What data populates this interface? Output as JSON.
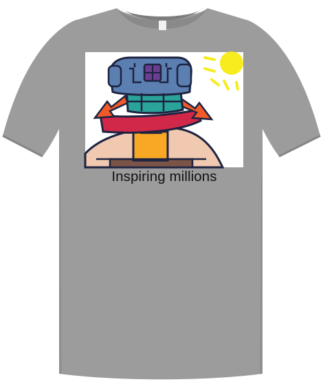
{
  "product": {
    "kind": "t-shirt",
    "print_caption": "Inspiring millions"
  },
  "colors": {
    "shirt": "#9c9c9c",
    "shirt_shadow": "#8a8a8a",
    "print_background": "#ffffff",
    "sun": "#f6ec1e",
    "outline": "#1d2340",
    "robot_blue": "#5b7fb0",
    "robot_teal": "#2aa39a",
    "robot_purple": "#6a3d8f",
    "robot_red": "#d1284a",
    "arrow_orange": "#f05a2a",
    "ground_peach": "#f1c9b1",
    "panel_orange": "#f9a825",
    "base_brown": "#7b5448"
  },
  "icons": {
    "collar_tag": "tag-icon"
  }
}
